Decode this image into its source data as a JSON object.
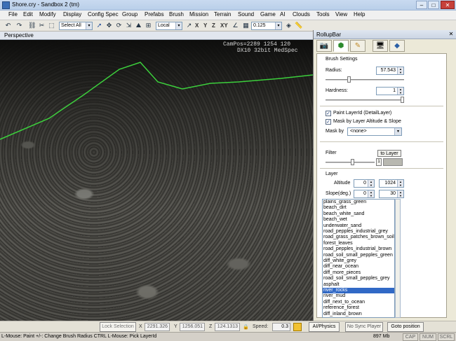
{
  "window": {
    "title": "Shore.cry - Sandbox 2 (tm)",
    "min": "–",
    "max": "□",
    "close": "✕"
  },
  "menu": [
    "File",
    "Edit",
    "Modify",
    "Display",
    "Config Spec",
    "Group",
    "Prefabs",
    "Brush",
    "Mission",
    "Terrain",
    "Sound",
    "Game",
    "AI",
    "Clouds",
    "Tools",
    "View",
    "Help"
  ],
  "toolbar": {
    "select_mode": "Select All",
    "coord_system": "Local",
    "axis_x": "X",
    "axis_y": "Y",
    "axis_z": "Z",
    "axis_xy": "XY",
    "grid_size": "0.125"
  },
  "viewport": {
    "title": "Perspective",
    "cam_pos": "CamPos=2289 1254 120",
    "build": "DX10 32bit MedSpec"
  },
  "rollup": {
    "title": "RollupBar",
    "close": "✕",
    "tabs": [
      "objects",
      "terrain",
      "modelling",
      "display",
      "layers"
    ]
  },
  "brush": {
    "section": "Brush Settings",
    "radius_label": "Radius:",
    "radius_value": "57.543",
    "radius_fraction": 0.29,
    "hardness_label": "Hardness:",
    "hardness_value": "1",
    "hardness_fraction": 1.0,
    "paint_layer_label": "Paint LayerId (DetailLayer)",
    "paint_layer_checked": true,
    "mask_altitude_label": "Mask by Layer Altitude & Slope",
    "mask_altitude_checked": true,
    "mask_by_label": "Mask by",
    "mask_by_value": "<none>"
  },
  "filter": {
    "label": "Filter",
    "to_layer_button": "to Layer",
    "value": "1",
    "fraction": 0.55,
    "color": "#b8b8b0"
  },
  "layer": {
    "section": "Layer",
    "altitude_label": "Altitude",
    "altitude_min": "0",
    "altitude_max": "1024",
    "slope_label": "Slope(deg.)",
    "slope_min": "0",
    "slope_max": "30",
    "items": [
      "plains_grass_green",
      "beach_dirt",
      "beach_white_sand",
      "beach_wet",
      "underwater_sand",
      "road_pepples_industrial_grey",
      "road_grass_patches_brown_soil",
      "forest_leaves",
      "road_pepples_industrial_brown",
      "road_soil_small_pepples_green",
      "diff_white_grey",
      "diff_near_ocean",
      "diff_more_pieces",
      "road_soil_small_pepples_grey",
      "asphalt",
      "river_rocks",
      "river_mud",
      "diff_next_to_ocean",
      "reference_forest",
      "diff_inland_brown"
    ],
    "selected_index": 15
  },
  "status": {
    "lock_selection": "Lock Selection",
    "x_label": "X",
    "x_value": "2291.326",
    "y_label": "Y",
    "y_value": "1256.051",
    "z_label": "Z",
    "z_value": "124.1313",
    "speed_label": "Speed:",
    "speed_value": "0.3",
    "ai_physics": "AI/Physics",
    "no_sync": "No Sync Player",
    "goto": "Goto position"
  },
  "info": {
    "message": "L-Mouse: Paint   +/-: Change Brush Radius   CTRL L-Mouse: Pick LayerId",
    "memory": "897 Mb",
    "cap": "CAP",
    "num": "NUM",
    "scrl": "SCRL"
  },
  "colors": {
    "accent": "#3169c6",
    "boundary_line": "#3ccf3c",
    "close": "#c6403a"
  }
}
